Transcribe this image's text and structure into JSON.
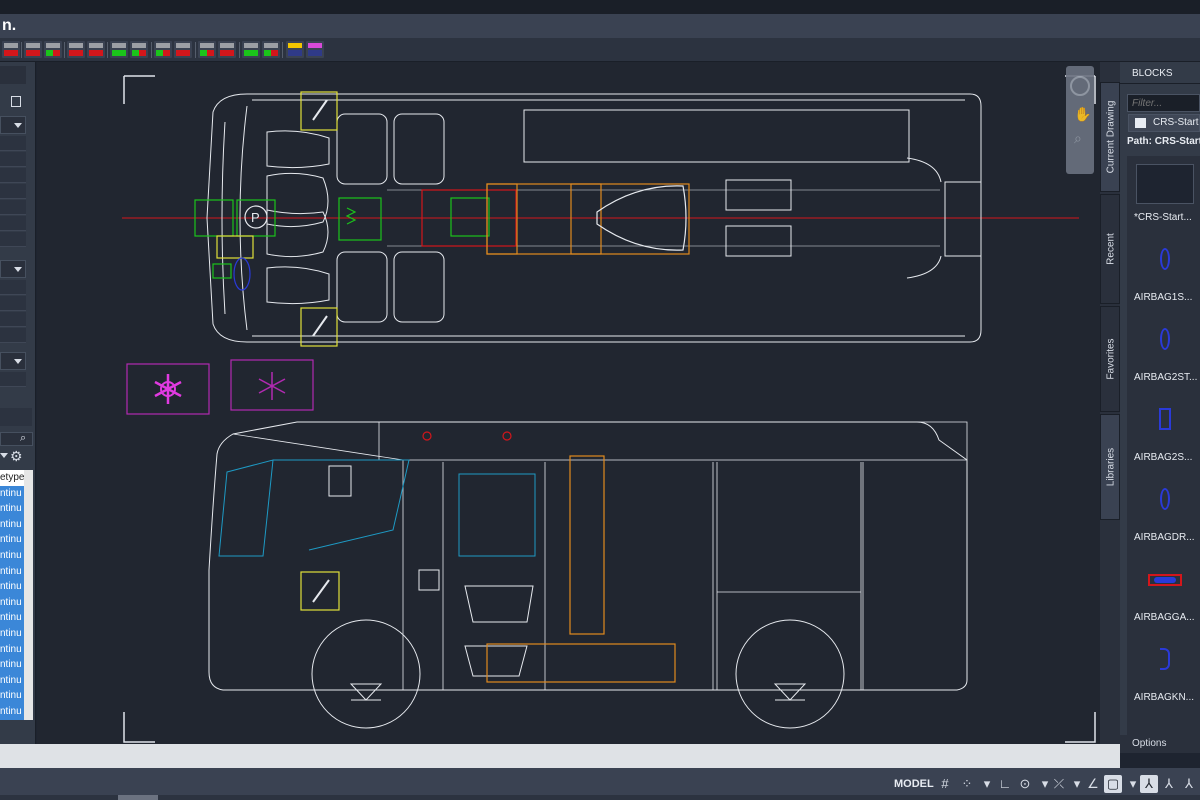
{
  "app": {
    "logo_text": "n.",
    "accent_color": "#3b87d8"
  },
  "toolbar": {
    "button_count": 16,
    "colors": {
      "red": "#d3161b",
      "green": "#1bc41b"
    }
  },
  "left_panel": {
    "linetype_list": {
      "items": [
        "etype",
        "ntinu",
        "ntinu",
        "ntinu",
        "ntinu",
        "ntinu",
        "ntinu",
        "ntinu",
        "ntinu",
        "ntinu",
        "ntinu",
        "ntinu",
        "ntinu",
        "ntinu",
        "ntinu",
        "ntinu"
      ]
    }
  },
  "side_tabs": {
    "current_drawing": "Current Drawing",
    "recent": "Recent",
    "favorites": "Favorites",
    "libraries": "Libraries"
  },
  "blocks_panel": {
    "title": "BLOCKS",
    "filter_placeholder": "Filter...",
    "source_button": "CRS-Startu",
    "path_label": "Path: CRS-Start",
    "items": [
      {
        "label": "*CRS-Start...",
        "icon": "empty-block-thumb"
      },
      {
        "label": "AIRBAG1S...",
        "icon": "airbag-oval-icon"
      },
      {
        "label": "AIRBAG2ST...",
        "icon": "airbag-oval-icon"
      },
      {
        "label": "AIRBAG2S...",
        "icon": "airbag-rect-icon"
      },
      {
        "label": "AIRBAGDR...",
        "icon": "airbag-oval-icon"
      },
      {
        "label": "AIRBAGGA...",
        "icon": "airbag-gas-icon"
      },
      {
        "label": "AIRBAGKN...",
        "icon": "airbag-knee-icon"
      }
    ],
    "options_label": "Options"
  },
  "status_bar": {
    "model_label": "MODEL"
  }
}
